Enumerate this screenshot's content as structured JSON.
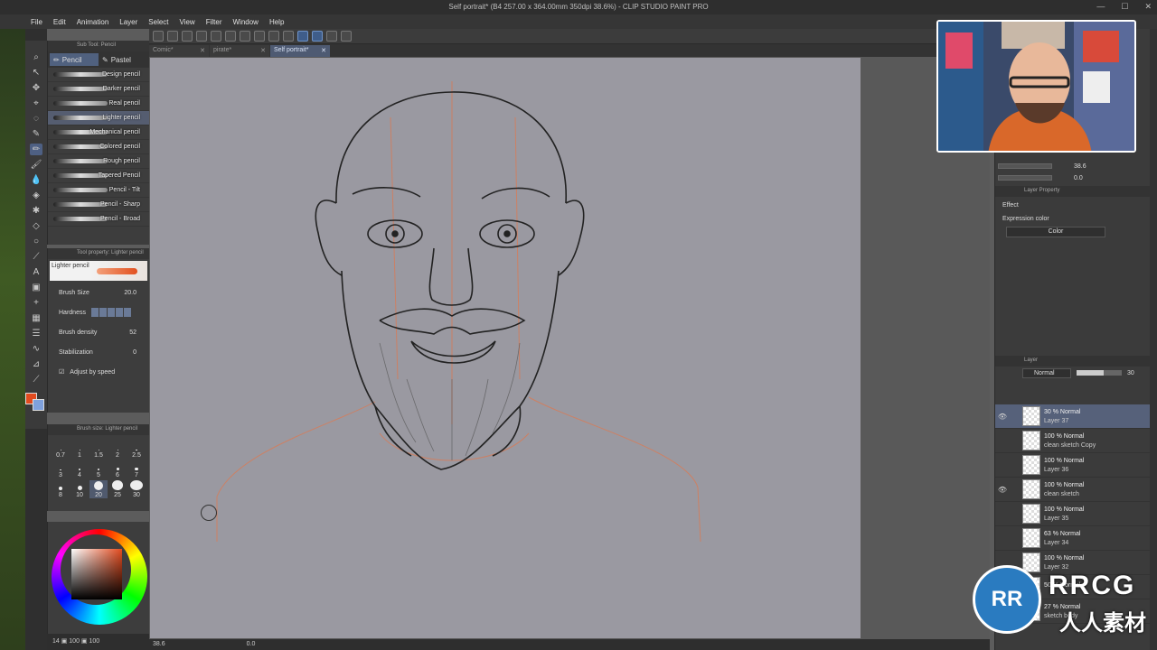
{
  "window": {
    "title": "Self portrait* (B4 257.00 x 364.00mm 350dpi 38.6%) - CLIP STUDIO PAINT PRO"
  },
  "menu": [
    "File",
    "Edit",
    "Animation",
    "Layer",
    "Select",
    "View",
    "Filter",
    "Window",
    "Help"
  ],
  "tabs": [
    {
      "label": "Comic*"
    },
    {
      "label": "pirate*"
    },
    {
      "label": "Self portrait*"
    }
  ],
  "subtool": {
    "header": "Sub Tool: Pencil",
    "group_tabs": [
      "Pencil",
      "Pastel"
    ],
    "brushes": [
      "Design pencil",
      "Darker pencil",
      "Real pencil",
      "Lighter pencil",
      "Mechanical pencil",
      "Colored pencil",
      "Rough pencil",
      "Tapered Pencil",
      "Pencil - Tilt",
      "Pencil - Sharp",
      "Pencil - Broad"
    ],
    "selected_index": 3
  },
  "toolprop": {
    "header": "Tool property: Lighter pencil",
    "preview_label": "Lighter pencil",
    "brush_size_label": "Brush Size",
    "brush_size_value": "20.0",
    "hardness_label": "Hardness",
    "density_label": "Brush density",
    "density_value": "52",
    "stabilization_label": "Stabilization",
    "stabilization_value": "0",
    "adjust_label": "Adjust by speed"
  },
  "brushsize": {
    "header": "Brush size: Lighter pencil",
    "sizes": [
      "0.7",
      "1",
      "1.5",
      "2",
      "2.5",
      "3",
      "4",
      "5",
      "6",
      "7",
      "8",
      "10",
      "20",
      "25",
      "30"
    ],
    "selected": "20"
  },
  "colors": {
    "main": "#e24b1f",
    "sub": "#7fa1dd",
    "accent": "#4e6083"
  },
  "bottom": {
    "text": "14 ▣ 100 ▣ 100"
  },
  "status": {
    "zoom": "38.6",
    "angle": "0.0"
  },
  "navigator": {
    "zoom": "38.6",
    "angle": "0.0"
  },
  "layerprop": {
    "header": "Layer Property",
    "effect": "Effect",
    "expression_label": "Expression color",
    "expression_value": "Color"
  },
  "layerpanel": {
    "header": "Layer",
    "blend": "Normal",
    "opacity": "30",
    "layers": [
      {
        "mode": "30 % Normal",
        "name": "Layer 37",
        "visible": true,
        "selected": true
      },
      {
        "mode": "100 % Normal",
        "name": "clean sketch Copy",
        "visible": false,
        "selected": false
      },
      {
        "mode": "100 % Normal",
        "name": "Layer 36",
        "visible": false,
        "selected": false
      },
      {
        "mode": "100 % Normal",
        "name": "clean sketch",
        "visible": true,
        "selected": false
      },
      {
        "mode": "100 % Normal",
        "name": "Layer 35",
        "visible": false,
        "selected": false
      },
      {
        "mode": "63 % Normal",
        "name": "Layer 34",
        "visible": false,
        "selected": false
      },
      {
        "mode": "100 % Normal",
        "name": "Layer 32",
        "visible": false,
        "selected": false
      },
      {
        "mode": "50 % Normal",
        "name": "",
        "visible": false,
        "selected": false
      },
      {
        "mode": "27 % Normal",
        "name": "sketch body",
        "visible": false,
        "selected": false
      }
    ]
  },
  "watermark": {
    "logo": "RR",
    "top": "RRCG",
    "bottom": "人人素材"
  }
}
